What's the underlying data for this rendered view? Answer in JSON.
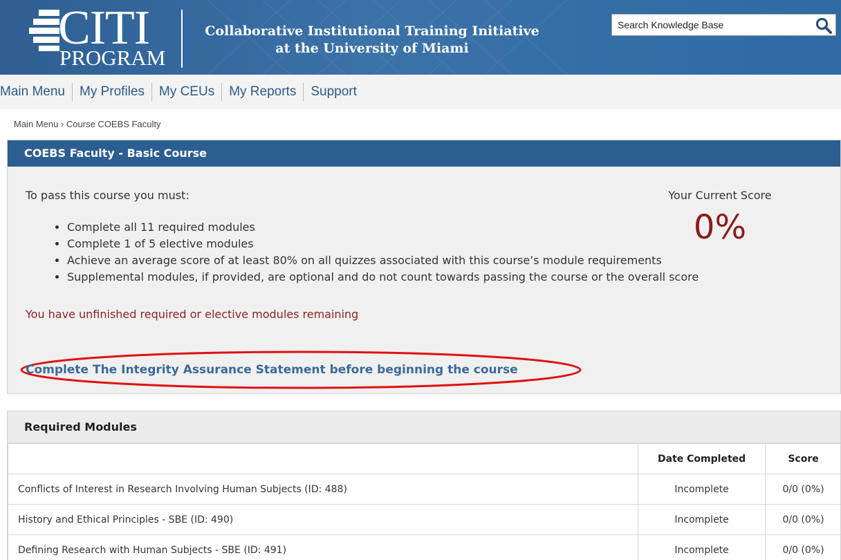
{
  "header": {
    "logo_main": "CITI",
    "logo_sub": "PROGRAM",
    "org_line1": "Collaborative Institutional Training Initiative",
    "org_line2": "at the University of Miami",
    "search_placeholder": "Search Knowledge Base",
    "search_icon": "magnifier-icon"
  },
  "nav": {
    "items": [
      "Main Menu",
      "My Profiles",
      "My CEUs",
      "My Reports",
      "Support"
    ]
  },
  "breadcrumb": {
    "root": "Main Menu",
    "separator": "›",
    "current": "Course COEBS Faculty"
  },
  "course": {
    "title": "COEBS Faculty - Basic Course",
    "pass_intro": "To pass this course you must:",
    "requirements": [
      "Complete all 11 required modules",
      "Complete 1 of 5 elective modules",
      "Achieve an average score of at least 80% on all quizzes associated with this course’s module requirements",
      "Supplemental modules, if provided, are optional and do not count towards passing the course or the overall score"
    ],
    "score_label": "Your Current Score",
    "score_value": "0%",
    "status_message": "You have unfinished required or elective modules remaining",
    "ias_link": "Complete The Integrity Assurance Statement before beginning the course"
  },
  "modules": {
    "title": "Required Modules",
    "columns": [
      "",
      "Date Completed",
      "Score"
    ],
    "rows": [
      {
        "name": "Conflicts of Interest in Research Involving Human Subjects (ID: 488)",
        "date": "Incomplete",
        "score": "0/0 (0%)"
      },
      {
        "name": "History and Ethical Principles - SBE (ID: 490)",
        "date": "Incomplete",
        "score": "0/0 (0%)"
      },
      {
        "name": "Defining Research with Human Subjects - SBE (ID: 491)",
        "date": "Incomplete",
        "score": "0/0 (0%)"
      }
    ]
  },
  "colors": {
    "header_blue": "#2f5f93",
    "nav_link": "#2d5a88",
    "panel_head": "#2c5e91",
    "score_red": "#8b1a1a",
    "annotation_red": "#e01010"
  }
}
